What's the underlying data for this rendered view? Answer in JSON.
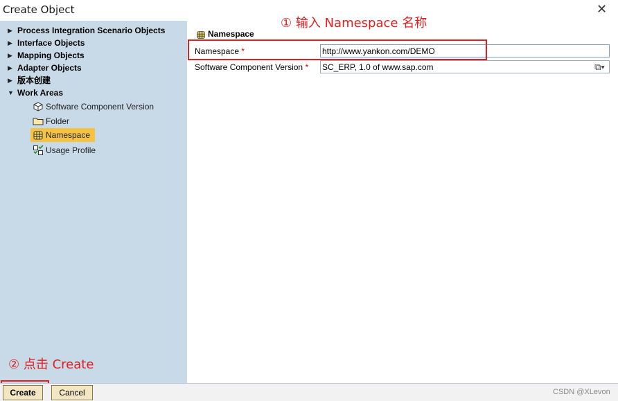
{
  "window": {
    "title": "Create Object",
    "close_glyph": "✕"
  },
  "sidebar": {
    "groups": [
      {
        "label": "Process Integration Scenario Objects",
        "expanded": false
      },
      {
        "label": "Interface Objects",
        "expanded": false
      },
      {
        "label": "Mapping Objects",
        "expanded": false
      },
      {
        "label": "Adapter Objects",
        "expanded": false
      },
      {
        "label": "版本创建",
        "expanded": false
      },
      {
        "label": "Work Areas",
        "expanded": true
      }
    ],
    "work_area_items": [
      {
        "label": "Software Component Version",
        "icon": "software-component-icon",
        "selected": false
      },
      {
        "label": "Folder",
        "icon": "folder-icon",
        "selected": false
      },
      {
        "label": "Namespace",
        "icon": "namespace-icon",
        "selected": true
      },
      {
        "label": "Usage Profile",
        "icon": "usage-profile-icon",
        "selected": false
      }
    ],
    "collapsed_arrow": "▶",
    "expanded_arrow": "▼"
  },
  "form": {
    "section_title": "Namespace",
    "namespace": {
      "label": "Namespace",
      "required_mark": "*",
      "value": "http://www.yankon.com/DEMO"
    },
    "swcv": {
      "label": "Software Component Version",
      "required_mark": "*",
      "value": "SC_ERP, 1.0 of www.sap.com"
    },
    "value_help_glyph": "⧉▾"
  },
  "annotations": {
    "step1": "① 输入 Namespace 名称",
    "step2": "② 点击 Create"
  },
  "footer": {
    "create_label": "Create",
    "cancel_label": "Cancel",
    "watermark": "CSDN @XLevon"
  },
  "colors": {
    "sidebar_bg": "#c8d9e8",
    "selection": "#f5c242",
    "annotation_red": "#e02020",
    "button_bg": "#f3e6c3"
  }
}
